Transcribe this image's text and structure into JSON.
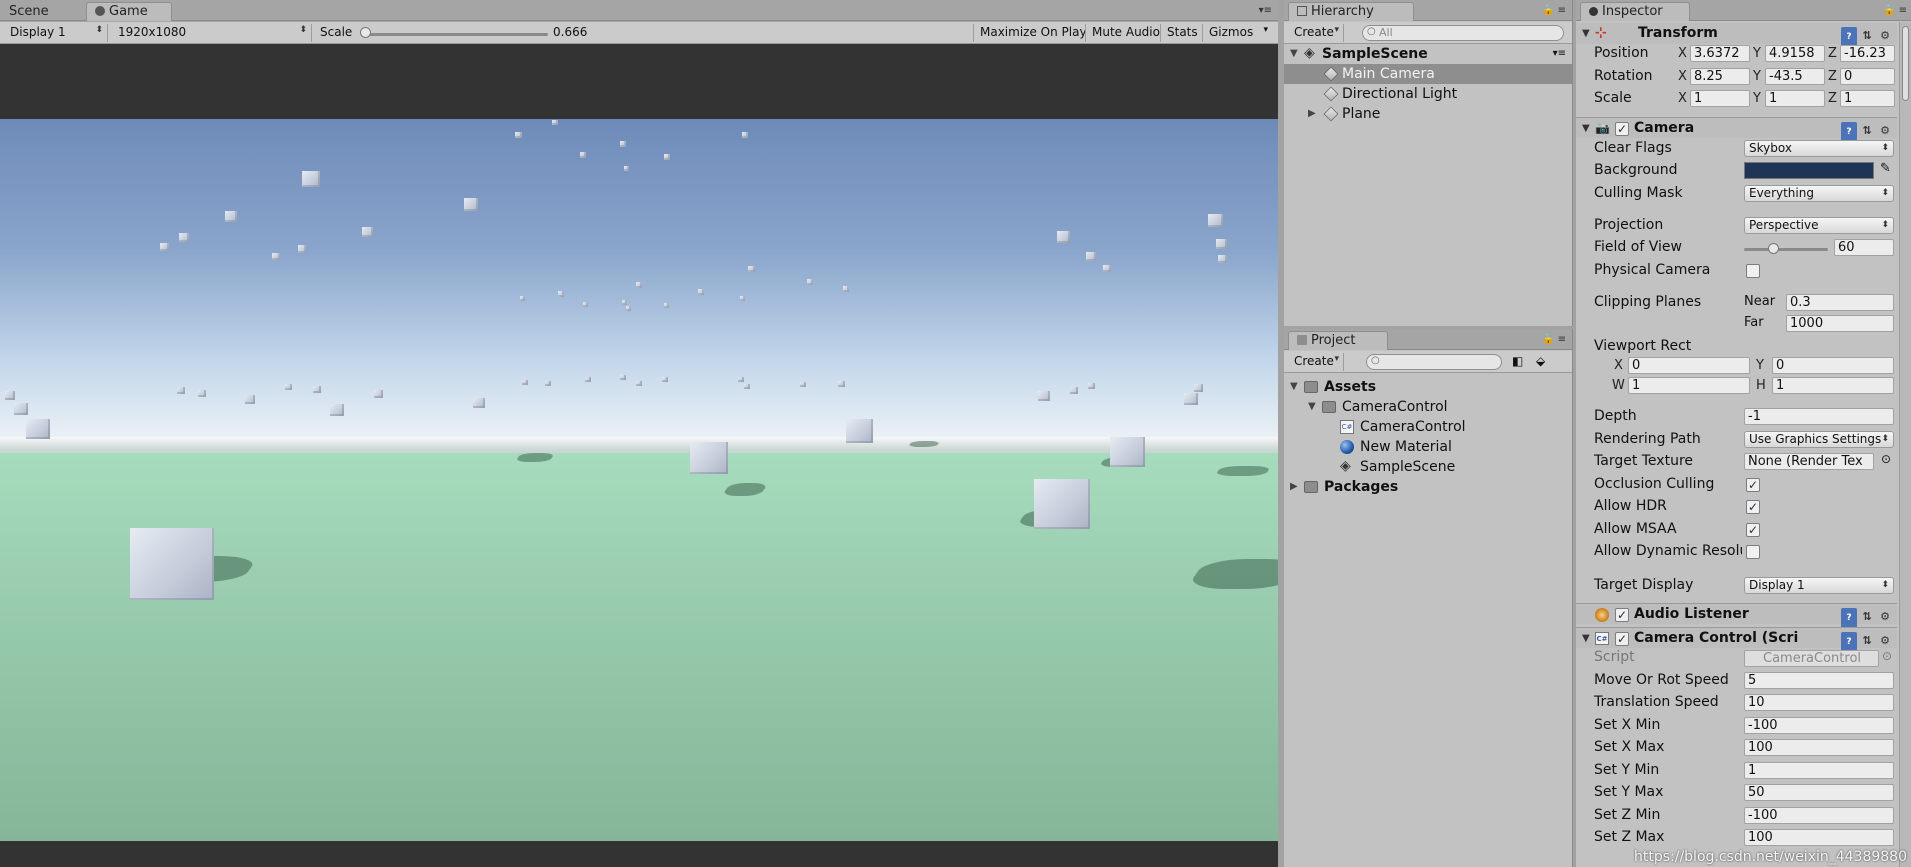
{
  "game": {
    "tabs": [
      {
        "label": "Scene"
      },
      {
        "label": "Game"
      }
    ],
    "toolbar": {
      "display": "Display 1",
      "resolution": "1920x1080",
      "scale_label": "Scale",
      "scale_value": "0.666",
      "scale_fraction": 0.0,
      "maximize": "Maximize On Play",
      "mute": "Mute Audio",
      "stats": "Stats",
      "gizmos": "Gizmos"
    }
  },
  "hierarchy": {
    "tab": "Hierarchy",
    "create": "Create",
    "search_placeholder": "All",
    "items": [
      {
        "label": "SampleScene"
      },
      {
        "label": "Main Camera"
      },
      {
        "label": "Directional Light"
      },
      {
        "label": "Plane"
      }
    ]
  },
  "project": {
    "tab": "Project",
    "create": "Create",
    "items": [
      {
        "label": "Assets"
      },
      {
        "label": "CameraControl"
      },
      {
        "label": "CameraControl"
      },
      {
        "label": "New Material"
      },
      {
        "label": "SampleScene"
      },
      {
        "label": "Packages"
      }
    ]
  },
  "inspector": {
    "tab": "Inspector",
    "transform": {
      "title": "Transform",
      "position_label": "Position",
      "rotation_label": "Rotation",
      "scale_label": "Scale",
      "axis_x": "X",
      "axis_y": "Y",
      "axis_z": "Z",
      "position": {
        "x": "3.6372",
        "y": "4.9158",
        "z": "-16.23"
      },
      "rotation": {
        "x": "8.25",
        "y": "-43.5",
        "z": "0"
      },
      "scale": {
        "x": "1",
        "y": "1",
        "z": "1"
      }
    },
    "camera": {
      "title": "Camera",
      "clear_flags_label": "Clear Flags",
      "clear_flags": "Skybox",
      "background_label": "Background",
      "background_color": "#1f3556",
      "culling_mask_label": "Culling Mask",
      "culling_mask": "Everything",
      "projection_label": "Projection",
      "projection": "Perspective",
      "fov_label": "Field of View",
      "fov": "60",
      "physical_label": "Physical Camera",
      "clipping_label": "Clipping Planes",
      "near_label": "Near",
      "near": "0.3",
      "far_label": "Far",
      "far": "1000",
      "viewport_label": "Viewport Rect",
      "vx_label": "X",
      "vx": "0",
      "vy_label": "Y",
      "vy": "0",
      "vw_label": "W",
      "vw": "1",
      "vh_label": "H",
      "vh": "1",
      "depth_label": "Depth",
      "depth": "-1",
      "rendering_path_label": "Rendering Path",
      "rendering_path": "Use Graphics Settings",
      "target_texture_label": "Target Texture",
      "target_texture": "None (Render Tex",
      "occlusion_label": "Occlusion Culling",
      "hdr_label": "Allow HDR",
      "msaa_label": "Allow MSAA",
      "dynres_label": "Allow Dynamic Resolu",
      "target_display_label": "Target Display",
      "target_display": "Display 1"
    },
    "audio_listener": {
      "title": "Audio Listener"
    },
    "camera_control": {
      "title": "Camera Control (Scri",
      "script_label": "Script",
      "script": "CameraControl",
      "fields": [
        {
          "label": "Move Or Rot Speed",
          "value": "5"
        },
        {
          "label": "Translation Speed",
          "value": "10"
        },
        {
          "label": "Set X Min",
          "value": "-100"
        },
        {
          "label": "Set X Max",
          "value": "100"
        },
        {
          "label": "Set Y Min",
          "value": "1"
        },
        {
          "label": "Set Y Max",
          "value": "50"
        },
        {
          "label": "Set Z Min",
          "value": "-100"
        },
        {
          "label": "Set Z Max",
          "value": "100"
        }
      ]
    }
  },
  "watermark": "https://blog.csdn.net/weixin_44389880"
}
